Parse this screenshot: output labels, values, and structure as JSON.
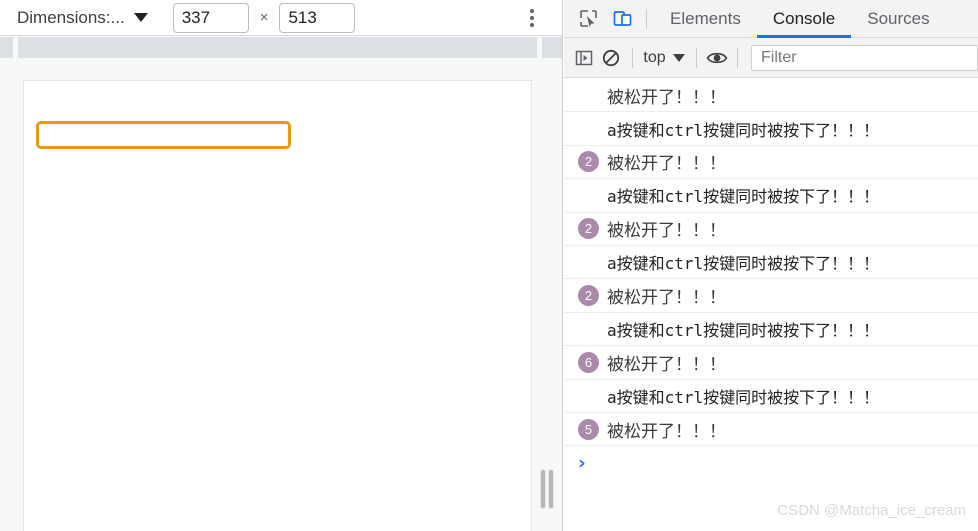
{
  "device_toolbar": {
    "dimensions_label": "Dimensions:...",
    "width_value": "337",
    "height_value": "513",
    "separator": "×",
    "menu_icon": "three-dots-vertical-icon",
    "caret_icon": "chevron-down-icon"
  },
  "page_viewport": {
    "input_value": "",
    "input_placeholder": "",
    "input_border_color": "#e79a14",
    "resize_handle_icon": "resize-grip-icon"
  },
  "devtools": {
    "toolbar_icons": [
      {
        "name": "inspect-element-icon",
        "title": "Inspect"
      },
      {
        "name": "device-toolbar-icon",
        "title": "Toggle device toolbar"
      }
    ],
    "tabs": [
      {
        "label": "Elements",
        "active": false
      },
      {
        "label": "Console",
        "active": true
      },
      {
        "label": "Sources",
        "active": false
      }
    ],
    "active_tab_underline_color": "#1a73e8"
  },
  "console_toolbar": {
    "sidebar_icon": "console-sidebar-icon",
    "clear_icon": "clear-console-icon",
    "context_value": "top",
    "context_caret_icon": "chevron-down-icon",
    "eye_icon": "live-expression-eye-icon",
    "filter_value": "",
    "filter_placeholder": "Filter"
  },
  "console_messages": [
    {
      "count": null,
      "text": "被松开了！！！",
      "mono": false
    },
    {
      "count": null,
      "text": "a按键和ctrl按键同时被按下了！！！",
      "mono": true
    },
    {
      "count": "2",
      "text": "被松开了！！！",
      "mono": false
    },
    {
      "count": null,
      "text": "a按键和ctrl按键同时被按下了！！！",
      "mono": true
    },
    {
      "count": "2",
      "text": "被松开了！！！",
      "mono": false
    },
    {
      "count": null,
      "text": "a按键和ctrl按键同时被按下了！！！",
      "mono": true
    },
    {
      "count": "2",
      "text": "被松开了！！！",
      "mono": false
    },
    {
      "count": null,
      "text": "a按键和ctrl按键同时被按下了！！！",
      "mono": true
    },
    {
      "count": "6",
      "text": "被松开了！！！",
      "mono": false
    },
    {
      "count": null,
      "text": "a按键和ctrl按键同时被按下了！！！",
      "mono": true
    },
    {
      "count": "5",
      "text": "被松开了！！！",
      "mono": false
    }
  ],
  "console_prompt": {
    "caret": "›"
  },
  "watermark": {
    "text": "CSDN @Matcha_ice_cream"
  },
  "colors": {
    "badge": "#ab89ab",
    "prompt": "#3b78e7",
    "accent": "#1a73e8",
    "input_focus": "#e79a14"
  }
}
